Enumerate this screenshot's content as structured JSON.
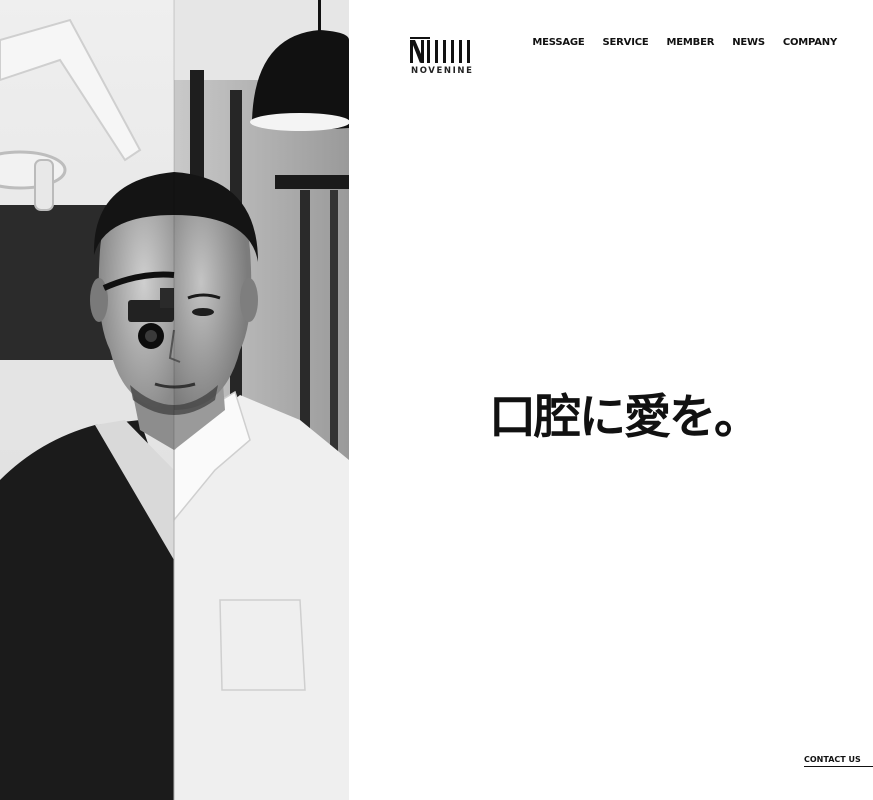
{
  "brand": {
    "logo_text": "NOVENINE"
  },
  "nav": {
    "items": [
      {
        "label": "MESSAGE"
      },
      {
        "label": "SERVICE"
      },
      {
        "label": "MEMBER"
      },
      {
        "label": "NEWS"
      },
      {
        "label": "COMPANY"
      }
    ]
  },
  "hero": {
    "catchphrase": "口腔に愛を。"
  },
  "footer": {
    "contact_label": "CONTACT US"
  },
  "colors": {
    "text": "#111111",
    "background": "#ffffff"
  }
}
